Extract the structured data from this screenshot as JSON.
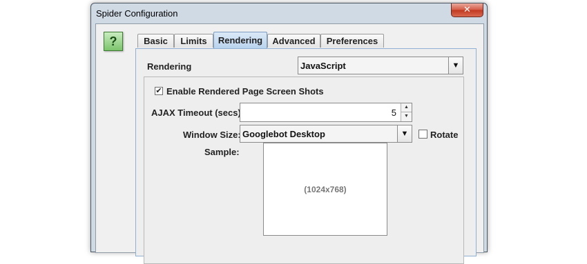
{
  "window": {
    "title": "Spider Configuration",
    "close_glyph": "✕"
  },
  "help": {
    "glyph": "?",
    "icon": "help-icon"
  },
  "tabs": [
    {
      "label": "Basic",
      "active": false
    },
    {
      "label": "Limits",
      "active": false
    },
    {
      "label": "Rendering",
      "active": true
    },
    {
      "label": "Advanced",
      "active": false
    },
    {
      "label": "Preferences",
      "active": false
    }
  ],
  "rendering": {
    "label": "Rendering",
    "selected": "JavaScript",
    "options_group": {
      "screenshots_label": "Enable Rendered Page Screen Shots",
      "screenshots_checked": true,
      "ajax_timeout_label": "AJAX Timeout (secs):",
      "ajax_timeout_value": "5",
      "window_size_label": "Window Size:",
      "window_size_value": "Googlebot Desktop",
      "rotate_label": "Rotate",
      "rotate_checked": false,
      "sample_label": "Sample:",
      "sample_size": "(1024x768)"
    }
  },
  "glyphs": {
    "check": "✔",
    "dropdown": "▼",
    "up": "▲",
    "down": "▼"
  },
  "colors": {
    "active_tab": "#b9d3ee",
    "help_green": "#7cc46c",
    "close_red": "#c0381f"
  }
}
